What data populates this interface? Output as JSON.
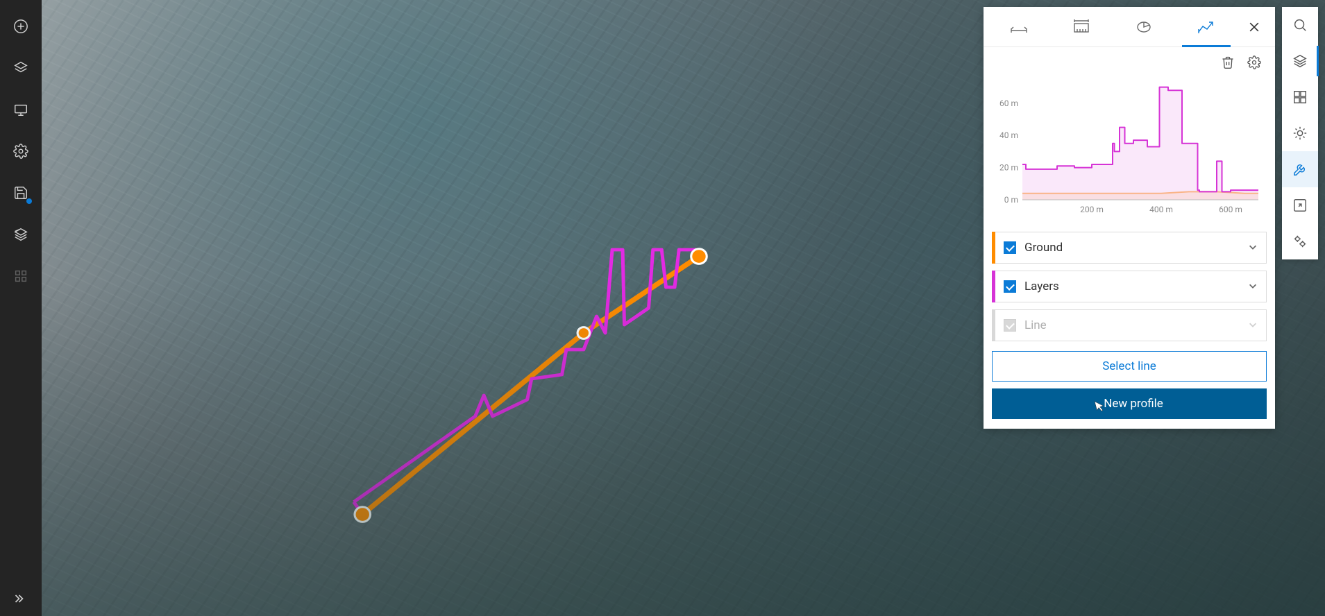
{
  "left_sidebar": {
    "add": "add",
    "layers": "layers",
    "present": "present",
    "settings": "settings",
    "save": "save",
    "legend": "legend",
    "apps": "apps",
    "expand": "expand"
  },
  "right_sidebar": {
    "search": "search",
    "layers": "layers",
    "basemap": "basemap",
    "daylight": "daylight",
    "tools": "tools",
    "share": "share",
    "config": "config"
  },
  "panel": {
    "tabs": {
      "measure_line": "measure-line",
      "measure_area": "measure-area",
      "slice": "slice",
      "elevation_profile": "elevation-profile"
    },
    "close": "close",
    "toolbar": {
      "delete": "delete",
      "settings": "settings"
    },
    "layers": {
      "ground": {
        "label": "Ground",
        "checked": true
      },
      "layers": {
        "label": "Layers",
        "checked": true
      },
      "line": {
        "label": "Line",
        "checked": true,
        "disabled": true
      }
    },
    "select_line_label": "Select line",
    "new_profile_label": "New profile"
  },
  "chart_data": {
    "type": "line",
    "title": "",
    "xlabel": "",
    "ylabel": "",
    "x_ticks": [
      "200 m",
      "400 m",
      "600 m"
    ],
    "y_ticks": [
      "0 m",
      "20 m",
      "40 m",
      "60 m"
    ],
    "xlim": [
      0,
      680
    ],
    "ylim": [
      0,
      75
    ],
    "series": [
      {
        "name": "Ground",
        "color": "#ff8c00",
        "x": [
          0,
          80,
          160,
          240,
          320,
          400,
          480,
          560,
          640,
          680
        ],
        "values": [
          4,
          4,
          4,
          4,
          4,
          4,
          5,
          5,
          4,
          4
        ]
      },
      {
        "name": "Layers",
        "color": "#d633d6",
        "x": [
          0,
          10,
          10,
          100,
          100,
          150,
          150,
          200,
          200,
          260,
          260,
          265,
          265,
          280,
          280,
          295,
          295,
          320,
          320,
          360,
          360,
          395,
          395,
          420,
          420,
          460,
          460,
          505,
          505,
          510,
          510,
          560,
          560,
          575,
          575,
          600,
          600,
          680
        ],
        "values": [
          22,
          22,
          19,
          19,
          21,
          21,
          20,
          20,
          22,
          22,
          35,
          35,
          30,
          30,
          45,
          45,
          35,
          35,
          37,
          37,
          33,
          33,
          70,
          70,
          68,
          68,
          35,
          35,
          6,
          6,
          5,
          5,
          24,
          24,
          5,
          5,
          6,
          6
        ]
      }
    ]
  }
}
